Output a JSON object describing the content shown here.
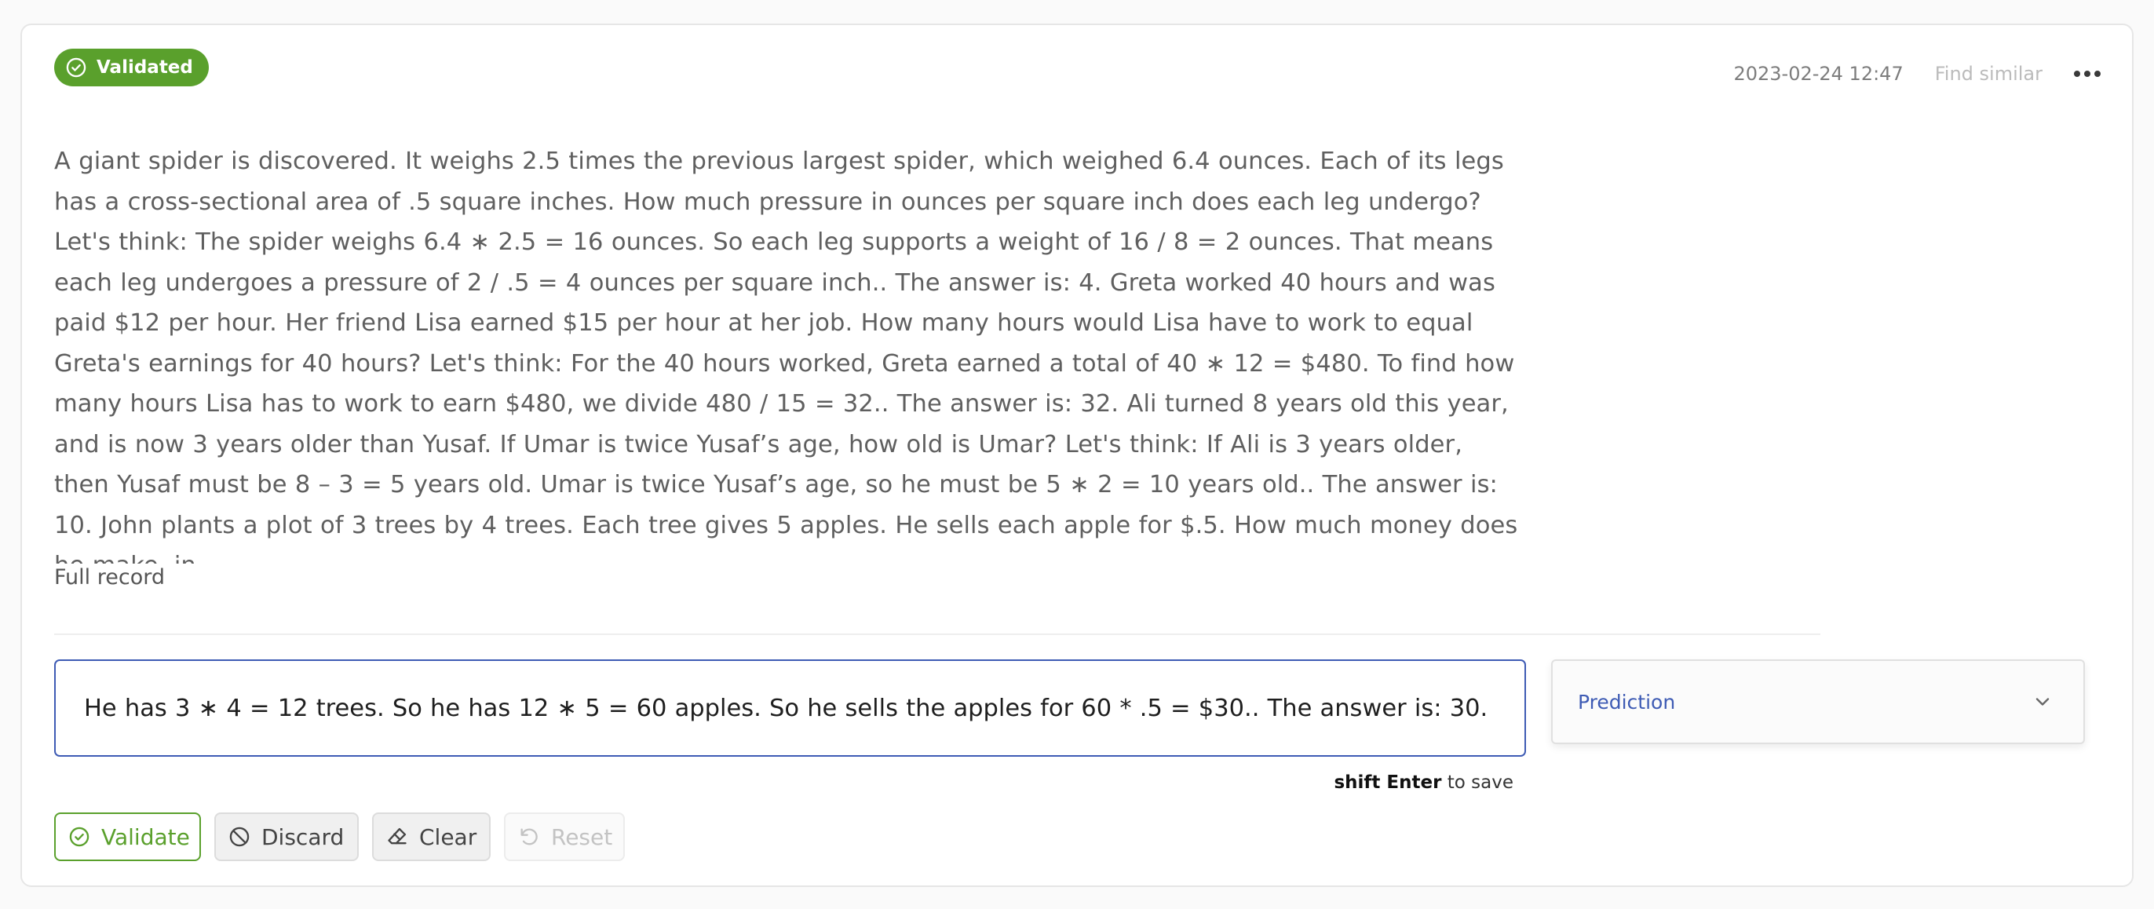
{
  "record": {
    "status_label": "Validated",
    "timestamp": "2023-02-24 12:47",
    "find_similar_label": "Find similar",
    "text": "A giant spider is discovered. It weighs 2.5 times the previous largest spider, which weighed 6.4 ounces. Each of its legs has a cross-sectional area of .5 square inches. How much pressure in ounces per square inch does each leg undergo? Let's think: The spider weighs 6.4 ∗ 2.5 = 16 ounces. So each leg supports a weight of 16 / 8 = 2 ounces. That means each leg undergoes a pressure of 2 / .5 = 4 ounces per square inch.. The answer is: 4. Greta worked 40 hours and was paid $12 per hour. Her friend Lisa earned $15 per hour at her job. How many hours would Lisa have to work to equal Greta's earnings for 40 hours? Let's think: For the 40 hours worked, Greta earned a total of 40 ∗ 12 = $480. To find how many hours Lisa has to work to earn $480, we divide 480 / 15 = 32.. The answer is: 32. Ali turned 8 years old this year, and is now 3 years older than Yusaf. If Umar is twice Yusaf’s age, how old is Umar? Let's think: If Ali is 3 years older, then Yusaf must be 8 – 3 = 5 years old. Umar is twice Yusaf’s age, so he must be 5 ∗ 2 = 10 years old.. The answer is: 10. John plants a plot of 3 trees by 4 trees. Each tree gives 5 apples. He sells each apple for $.5. How much money does he make, in",
    "full_record_label": "Full record"
  },
  "annotation": {
    "text_value": "He has 3 ∗ 4 = 12 trees. So he has 12 ∗ 5 = 60 apples. So he sells the apples for 60 * .5 = $30.. The answer is: 30.",
    "save_hint_key": "shift Enter",
    "save_hint_text": " to save"
  },
  "prediction": {
    "label": "Prediction"
  },
  "actions": {
    "validate_label": "Validate",
    "discard_label": "Discard",
    "clear_label": "Clear",
    "reset_label": "Reset"
  },
  "icons": {
    "status": "check-circle-icon",
    "more": "more-horizontal-icon",
    "dropdown": "chevron-down-icon",
    "validate": "check-circle-icon",
    "discard": "ban-icon",
    "clear": "eraser-icon",
    "reset": "undo-icon"
  },
  "colors": {
    "validated_green": "#5aa02c",
    "accent_blue": "#3e5bb4"
  }
}
